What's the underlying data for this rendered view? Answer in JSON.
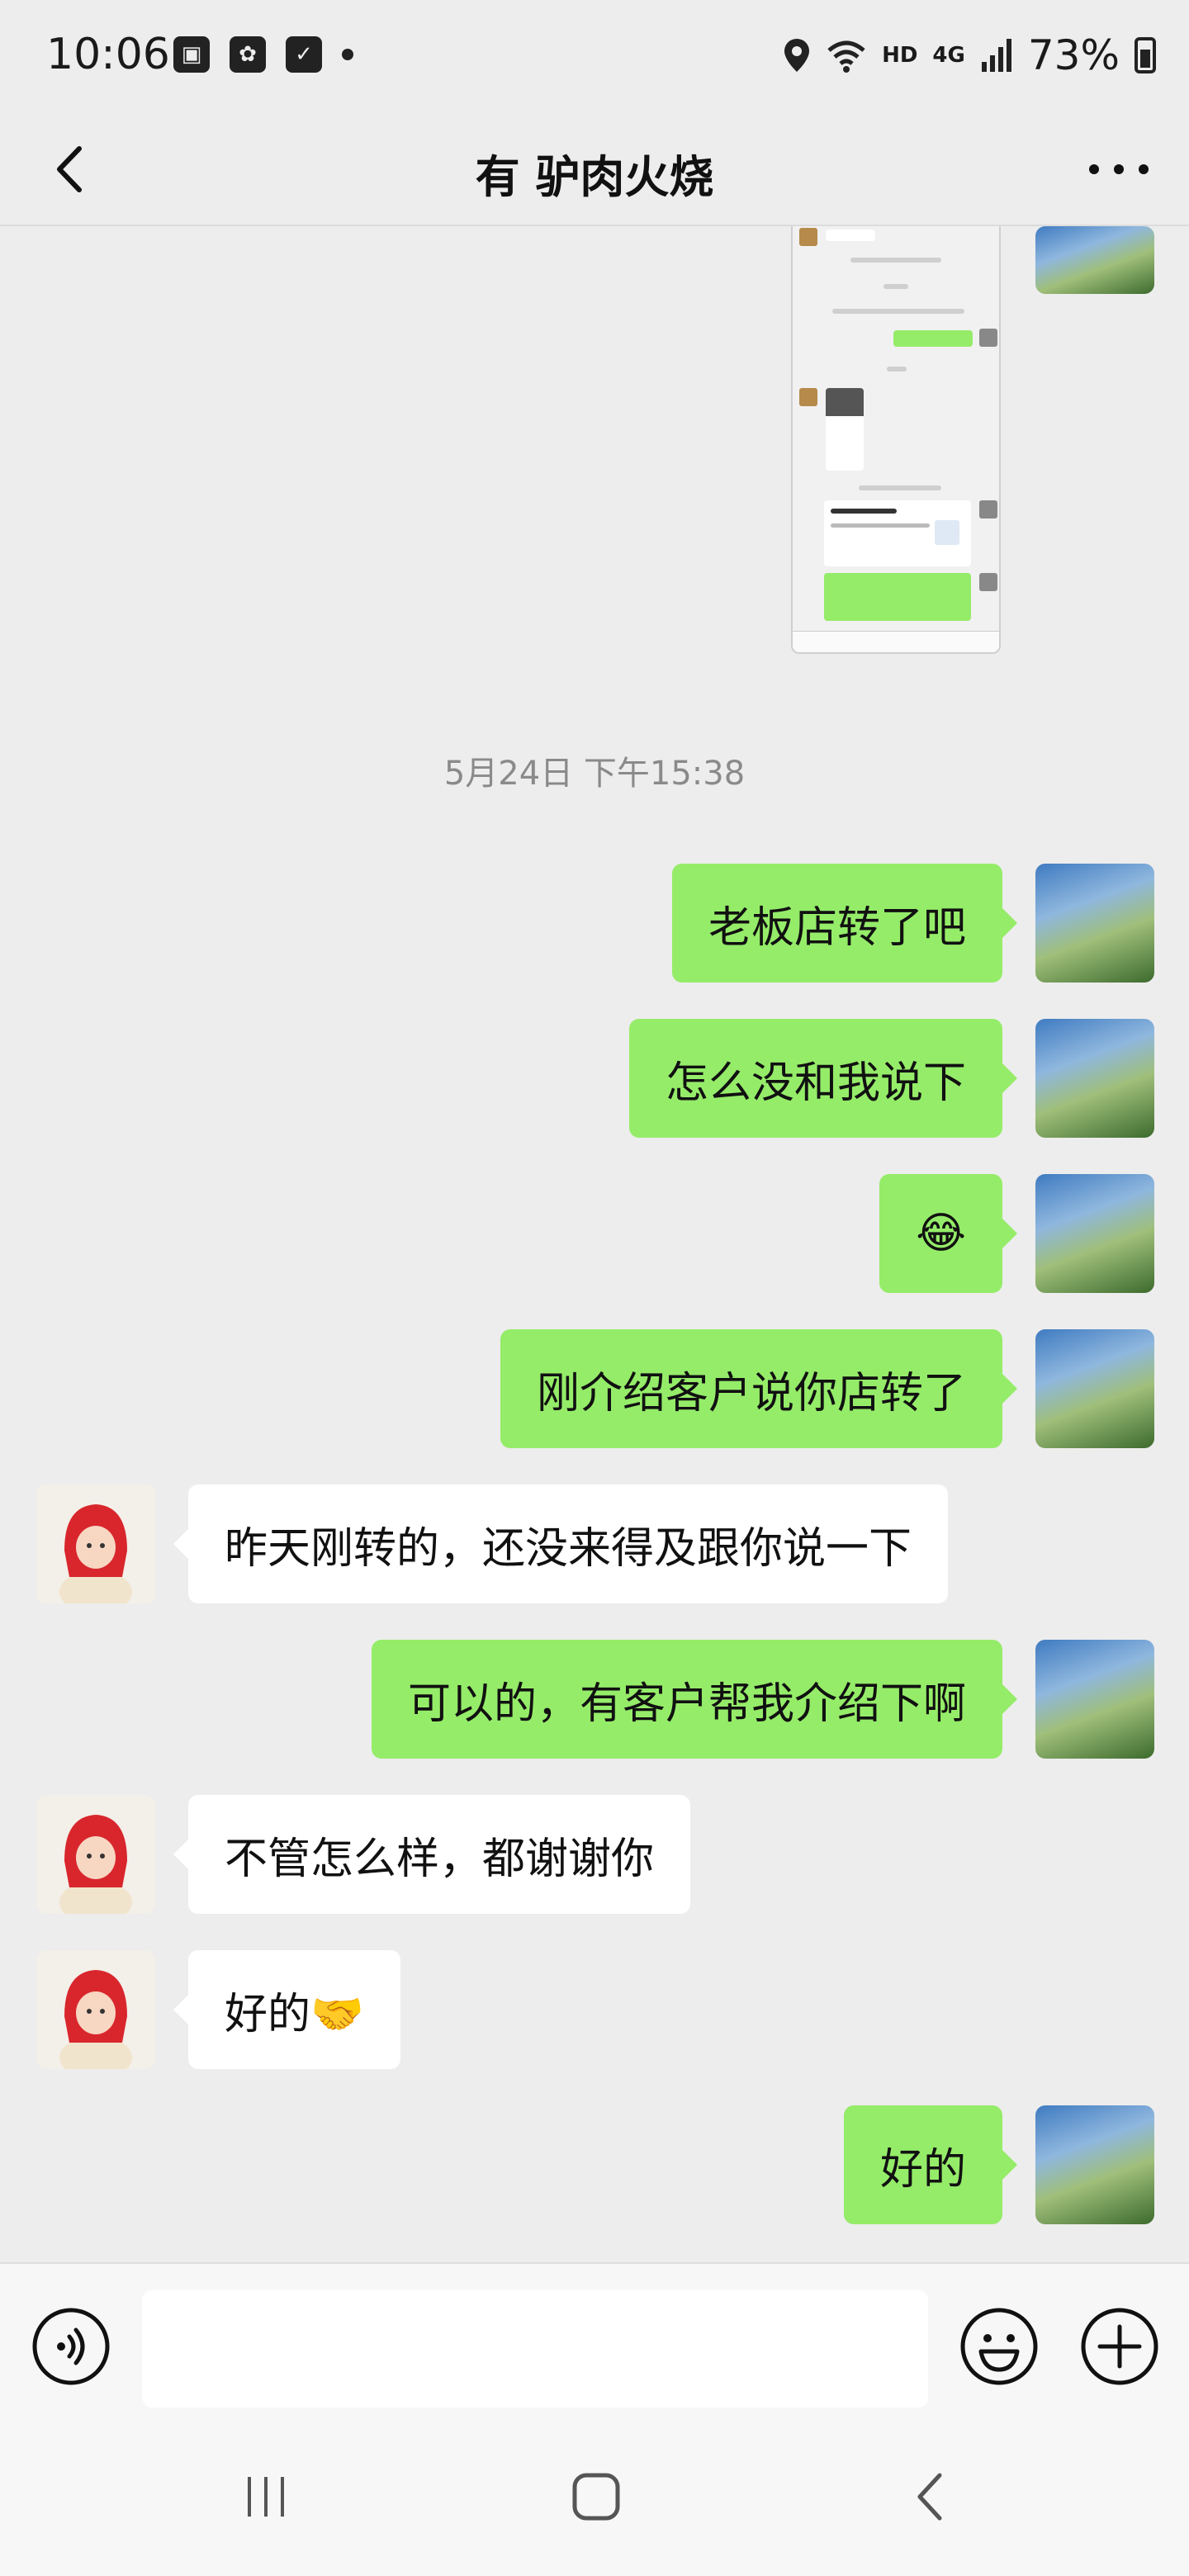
{
  "status_bar": {
    "time": "10:06",
    "network": "HD",
    "signal": "4G",
    "battery": "73%"
  },
  "header": {
    "title": "有 驴肉火烧"
  },
  "colors": {
    "my_bubble": "#95ec69",
    "other_bubble": "#ffffff",
    "background": "#ededed"
  },
  "timestamp": "5月24日 下午15:38",
  "messages": [
    {
      "sender": "me",
      "text": "老板店转了吧"
    },
    {
      "sender": "me",
      "text": "怎么没和我说下"
    },
    {
      "sender": "me",
      "text": "😂"
    },
    {
      "sender": "me",
      "text": "刚介绍客户说你店转了"
    },
    {
      "sender": "other",
      "text": "昨天刚转的，还没来得及跟你说一下"
    },
    {
      "sender": "me",
      "text": "可以的，有客户帮我介绍下啊"
    },
    {
      "sender": "other",
      "text": "不管怎么样，都谢谢你"
    },
    {
      "sender": "other",
      "text": "好的🤝"
    },
    {
      "sender": "me",
      "text": "好的"
    }
  ]
}
